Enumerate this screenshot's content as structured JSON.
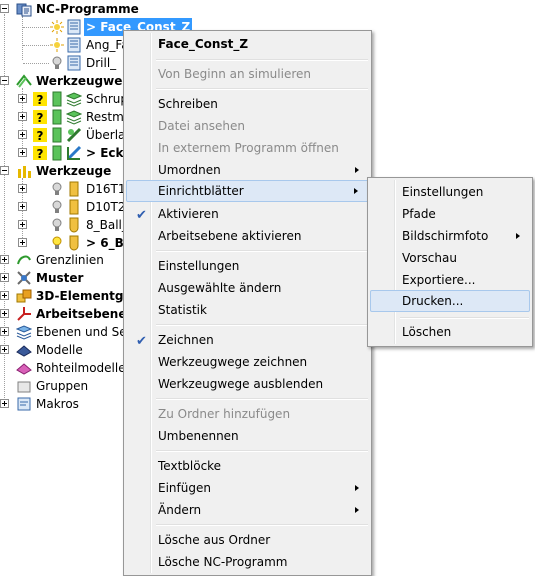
{
  "tree": {
    "nc_programs": {
      "label": "NC-Programme",
      "children": [
        {
          "label": "> Face_Const_Z"
        },
        {
          "label": "Ang_Fa"
        },
        {
          "label": "Drill_"
        }
      ]
    },
    "toolpaths": {
      "label": "Werkzeugwege",
      "children": [
        {
          "label": "Schrup"
        },
        {
          "label": "Restma"
        },
        {
          "label": "Überlap"
        },
        {
          "label": "> Ecke"
        }
      ]
    },
    "tools": {
      "label": "Werkzeuge",
      "children": [
        {
          "label": "D16T1"
        },
        {
          "label": "D10T2"
        },
        {
          "label": "8_Ball_"
        },
        {
          "label": "> 6_Ba"
        }
      ]
    },
    "roots": [
      {
        "label": "Grenzlinien",
        "bold": false
      },
      {
        "label": "Muster",
        "bold": true
      },
      {
        "label": "3D-Elementgru",
        "bold": true
      },
      {
        "label": "Arbeitsebenen",
        "bold": true
      },
      {
        "label": "Ebenen und Sets",
        "bold": false
      },
      {
        "label": "Modelle",
        "bold": false
      },
      {
        "label": "Rohteilmodelle",
        "bold": false
      },
      {
        "label": "Gruppen",
        "bold": false
      },
      {
        "label": "Makros",
        "bold": false
      }
    ]
  },
  "context_menu": {
    "header": "Face_Const_Z",
    "items": {
      "simulate": "Von Beginn an simulieren",
      "write": "Schreiben",
      "view_file": "Datei ansehen",
      "open_external": "In externem Programm öffnen",
      "reorder": "Umordnen",
      "setup_sheets": "Einrichtblätter",
      "activate": "Aktivieren",
      "activate_workplane": "Arbeitsebene aktivieren",
      "settings": "Einstellungen",
      "edit_selected": "Ausgewählte ändern",
      "statistics": "Statistik",
      "draw": "Zeichnen",
      "draw_toolpaths": "Werkzeugwege zeichnen",
      "hide_toolpaths": "Werkzeugwege ausblenden",
      "add_to_folder": "Zu Ordner hinzufügen",
      "rename": "Umbenennen",
      "text_blocks": "Textblöcke",
      "insert": "Einfügen",
      "edit": "Ändern",
      "delete_from_folder": "Lösche aus Ordner",
      "delete_nc": "Lösche NC-Programm"
    }
  },
  "submenu": {
    "items": {
      "settings": "Einstellungen",
      "paths": "Pfade",
      "screenshot": "Bildschirmfoto",
      "preview": "Vorschau",
      "export": "Exportiere...",
      "print": "Drucken...",
      "delete": "Löschen"
    }
  },
  "icons": {
    "check": "✔"
  },
  "colors": {
    "selection": "#3399ff",
    "menu_highlight": "#dde8f6"
  }
}
